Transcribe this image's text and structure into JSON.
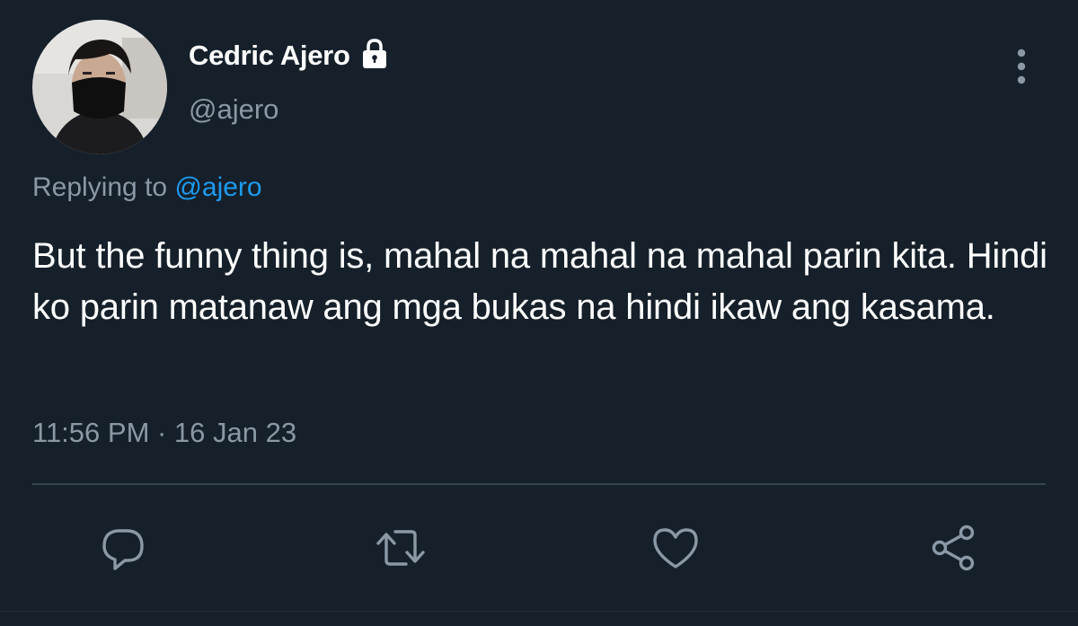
{
  "author": {
    "display_name": "Cedric Ajero",
    "handle": "@ajero",
    "protected": true,
    "avatar": "avatar-photo"
  },
  "reply": {
    "prefix": "Replying to",
    "handle": "@ajero"
  },
  "tweet": {
    "text": "But the funny thing is, mahal na mahal na mahal parin kita. Hindi ko parin matanaw ang mga bukas na hindi ikaw ang kasama.",
    "timestamp": "11:56 PM · 16 Jan 23"
  },
  "actions": [
    {
      "name": "reply",
      "icon": "comment-icon"
    },
    {
      "name": "retweet",
      "icon": "retweet-icon"
    },
    {
      "name": "like",
      "icon": "heart-icon"
    },
    {
      "name": "share",
      "icon": "share-icon"
    }
  ],
  "colors": {
    "background": "#15202b",
    "primary_text": "#ffffff",
    "secondary_text": "#8b98a5",
    "accent": "#1d9bf0",
    "divider": "#38444d"
  }
}
